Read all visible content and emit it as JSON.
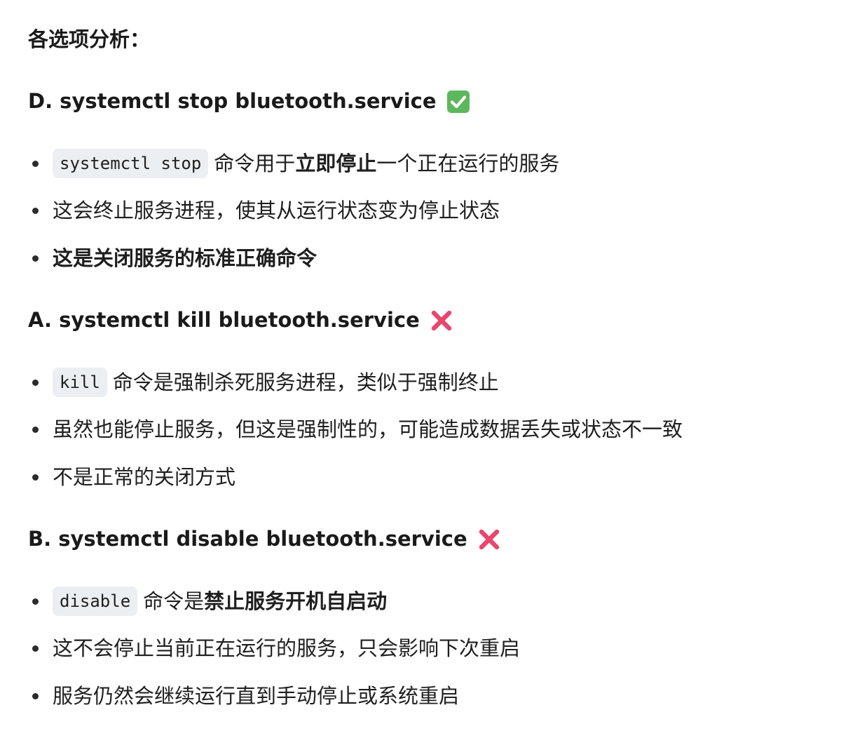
{
  "heading": "各选项分析：",
  "sections": [
    {
      "title": "D. systemctl stop bluetooth.service",
      "mark": "check-mark-icon",
      "bullets": [
        {
          "code": "systemctl stop",
          "before": "命令用于",
          "bold": "立即停止",
          "after": "一个正在运行的服务"
        },
        {
          "text": "这会终止服务进程，使其从运行状态变为停止状态"
        },
        {
          "bold_text": "这是关闭服务的标准正确命令"
        }
      ]
    },
    {
      "title": "A. systemctl kill bluetooth.service",
      "mark": "cross-mark-icon",
      "bullets": [
        {
          "code": "kill",
          "text": "命令是强制杀死服务进程，类似于强制终止"
        },
        {
          "text": "虽然也能停止服务，但这是强制性的，可能造成数据丢失或状态不一致"
        },
        {
          "text": "不是正常的关闭方式"
        }
      ]
    },
    {
      "title": "B. systemctl disable bluetooth.service",
      "mark": "cross-mark-icon",
      "bullets": [
        {
          "code": "disable",
          "before": "命令是",
          "bold": "禁止服务开机自启动"
        },
        {
          "text": "这不会停止当前正在运行的服务，只会影响下次重启"
        },
        {
          "text": "服务仍然会继续运行直到手动停止或系统重启"
        }
      ]
    }
  ],
  "colors": {
    "check_green": "#5cb85c",
    "cross_red": "#e8476b",
    "code_bg": "#eceff1",
    "text": "#1f1f1f"
  }
}
